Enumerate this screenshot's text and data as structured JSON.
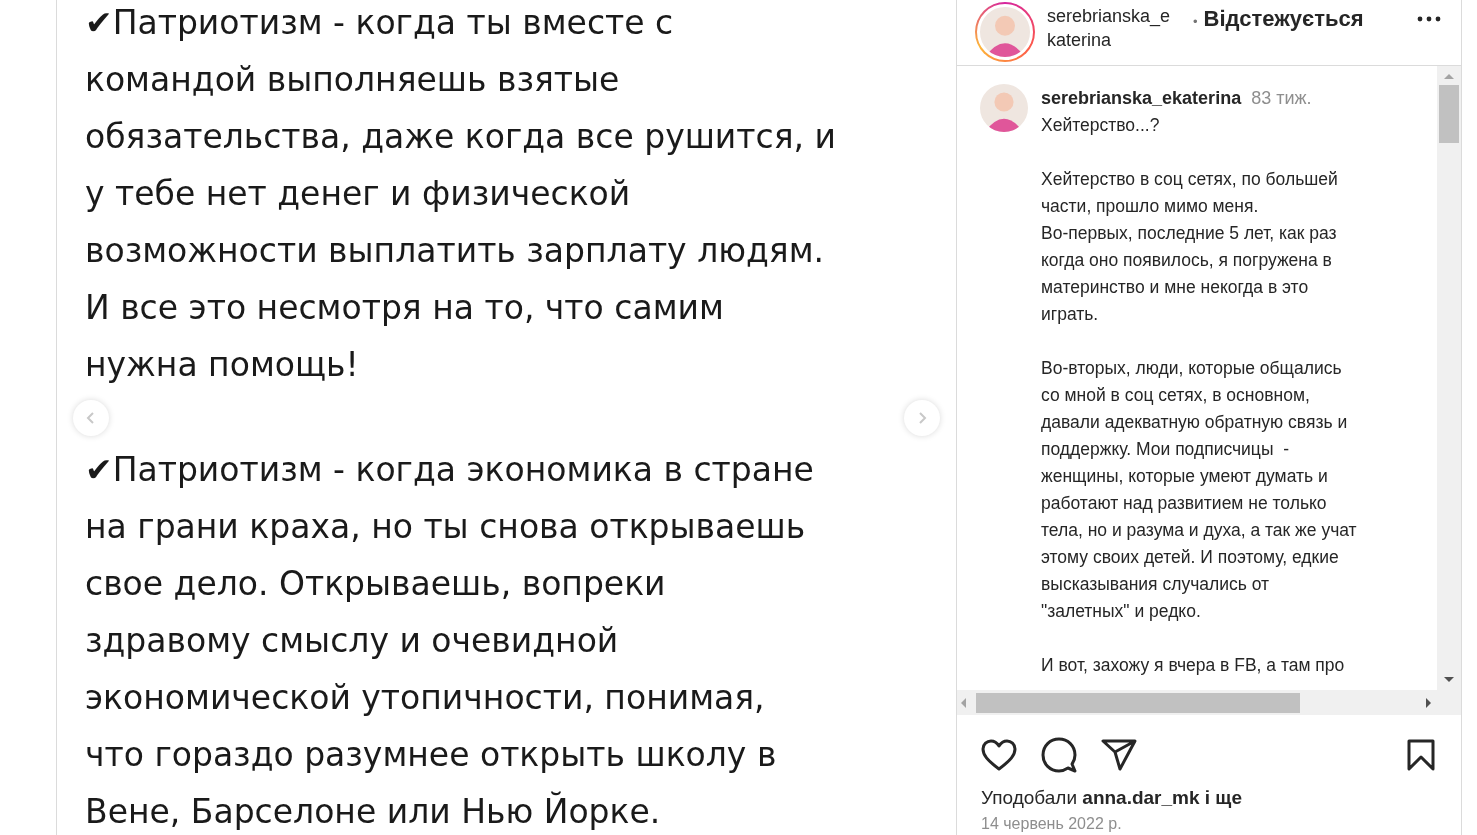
{
  "slide": {
    "paragraphs": [
      "✔Патриотизм - когда ты вместе с\nкомандой выполняешь взятые\nобязательства, даже когда все рушится, и\nу тебе нет денег и физической\nвозможности выплатить зарплату людям.\nИ все это несмотря на то, что самим\nнужна помощь!",
      "✔Патриотизм - когда экономика в стране\nна грани краха, но ты снова открываешь\nсвое дело. Открываешь, вопреки\nздравому смыслу и очевидной\nэкономической утопичности, понимая,\nчто гораздо разумнее открыть школу в\nВене, Барселоне или Нью Йорке."
    ]
  },
  "header": {
    "username": "serebrianska_ekaterina",
    "separator": "•",
    "follow_status": "Відстежується"
  },
  "comment": {
    "username": "serebrianska_ekaterina",
    "time": "83 тиж.",
    "paragraphs": [
      "Хейтерство...?",
      "Хейтерство в соц сетях, по большей\nчасти, прошло мимо меня.\nВо-первых, последние 5 лет, как раз\nкогда оно появилось, я погружена в\nматеринство и мне некогда в это\nиграть.",
      "Во-вторых, люди, которые общались\nсо мной в соц сетях, в основном,\nдавали адекватную обратную связь и\nподдержку. Мои подписчицы  -\nженщины, которые умеют думать и\nработают над развитием не только\nтела, но и разума и духа, а так же учат\nэтому своих детей. И поэтому, едкие\nвысказывания случались от\n\"залетных\" и редко.",
      "И вот, захожу я вчера в FB, а там про"
    ]
  },
  "actions": {
    "liked": false,
    "saved": false
  },
  "likes": "Уподобали **anna.dar_mk і ще**",
  "date": "14 червень 2022 р."
}
